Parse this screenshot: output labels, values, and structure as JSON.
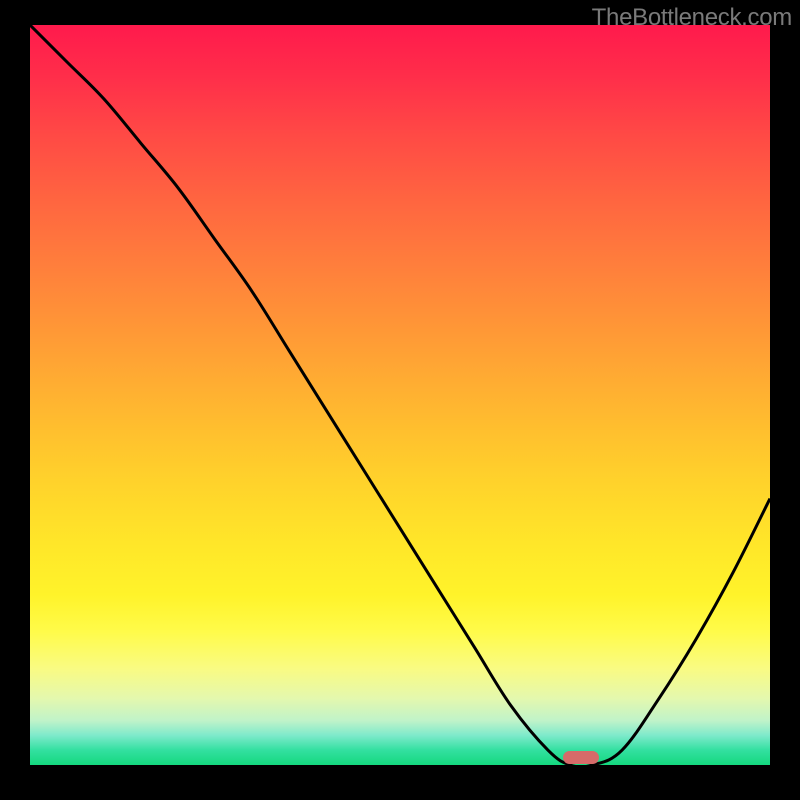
{
  "watermark": "TheBottleneck.com",
  "chart_data": {
    "type": "line",
    "title": "",
    "xlabel": "",
    "ylabel": "",
    "xlim": [
      0,
      100
    ],
    "ylim": [
      0,
      100
    ],
    "x": [
      0,
      5,
      10,
      15,
      20,
      25,
      30,
      35,
      40,
      45,
      50,
      55,
      60,
      65,
      70,
      73,
      76,
      80,
      85,
      90,
      95,
      100
    ],
    "values": [
      100,
      95,
      90,
      84,
      78,
      71,
      64,
      56,
      48,
      40,
      32,
      24,
      16,
      8,
      2,
      0,
      0,
      2,
      9,
      17,
      26,
      36
    ],
    "marker": {
      "x": 74.5,
      "y": 0.5,
      "color": "#d66b69"
    },
    "background": "rainbow-vertical-gradient",
    "curve_color": "#000000"
  },
  "colors": {
    "bg_black": "#000000",
    "watermark": "#7a7a7a",
    "marker": "#d66b69",
    "curve": "#000000"
  }
}
